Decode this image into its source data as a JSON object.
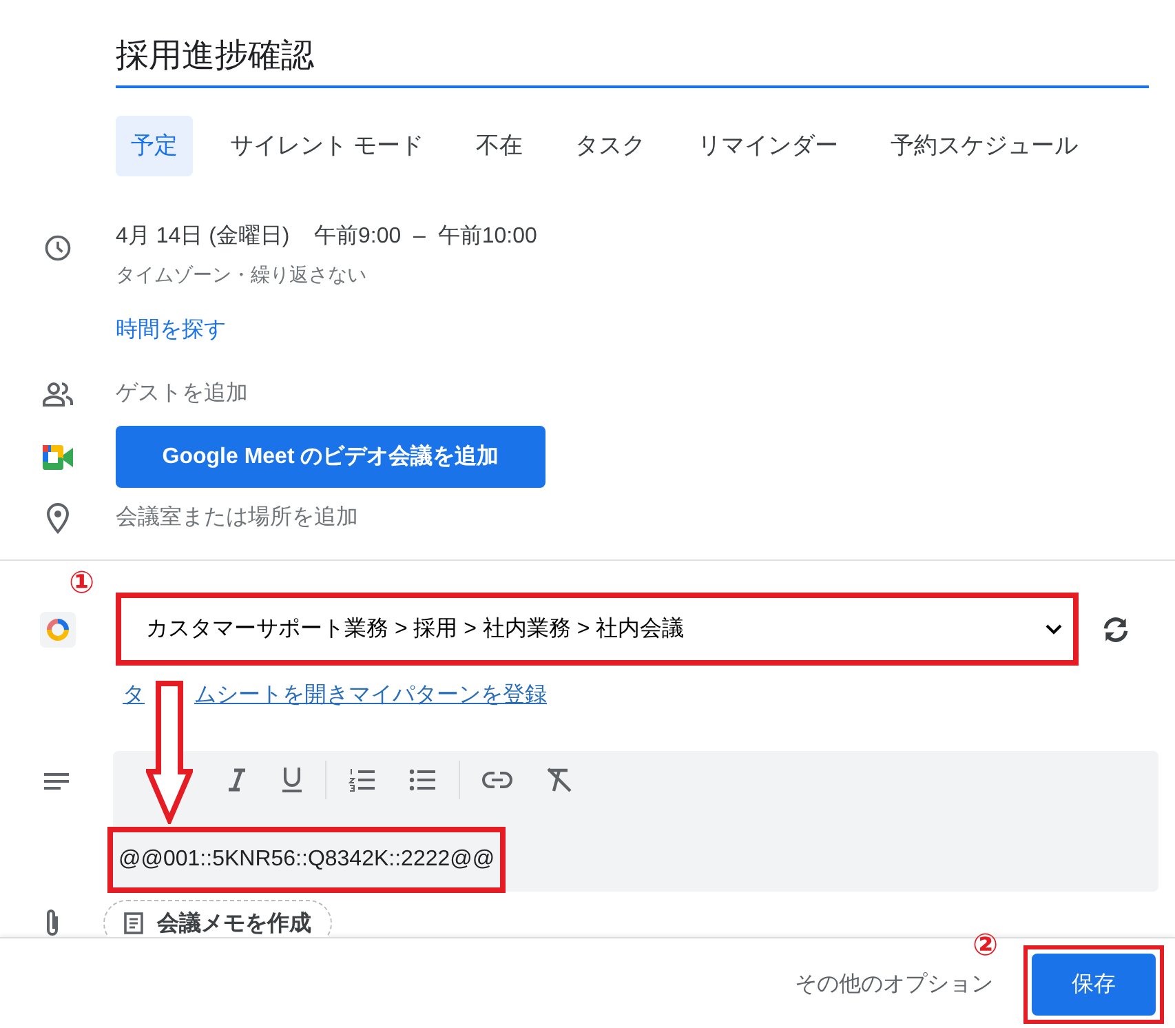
{
  "title": "採用進捗確認",
  "tabs": [
    {
      "label": "予定",
      "selected": true
    },
    {
      "label": "サイレント モード",
      "selected": false
    },
    {
      "label": "不在",
      "selected": false
    },
    {
      "label": "タスク",
      "selected": false
    },
    {
      "label": "リマインダー",
      "selected": false
    },
    {
      "label": "予約スケジュール",
      "selected": false
    }
  ],
  "datetime": {
    "date": "4月 14日 (金曜日)",
    "start": "午前9:00",
    "separator": "–",
    "end": "午前10:00",
    "details": "タイムゾーン・繰り返さない"
  },
  "find_time_link": "時間を探す",
  "guests": {
    "placeholder": "ゲストを追加"
  },
  "meet_button": "Google Meet のビデオ会議を追加",
  "location": {
    "placeholder": "会議室または場所を追加"
  },
  "timesheet": {
    "select_value": "カスタマーサポート業務 > 採用 > 社内業務 > 社内会議",
    "highlighted": true,
    "link_parts": [
      "タ",
      "ムシートを開きマイパターンを登録"
    ]
  },
  "description": {
    "value": "@@001::5KNR56::Q8342K::2222@@",
    "highlighted": true
  },
  "meeting_notes_button": "会議メモを作成",
  "footer": {
    "more_options": "その他のオプション",
    "save_button": "保存",
    "save_highlighted": true
  },
  "annotations": [
    {
      "kind": "number",
      "label": "①"
    },
    {
      "kind": "arrow"
    },
    {
      "kind": "number",
      "label": "②"
    }
  ]
}
